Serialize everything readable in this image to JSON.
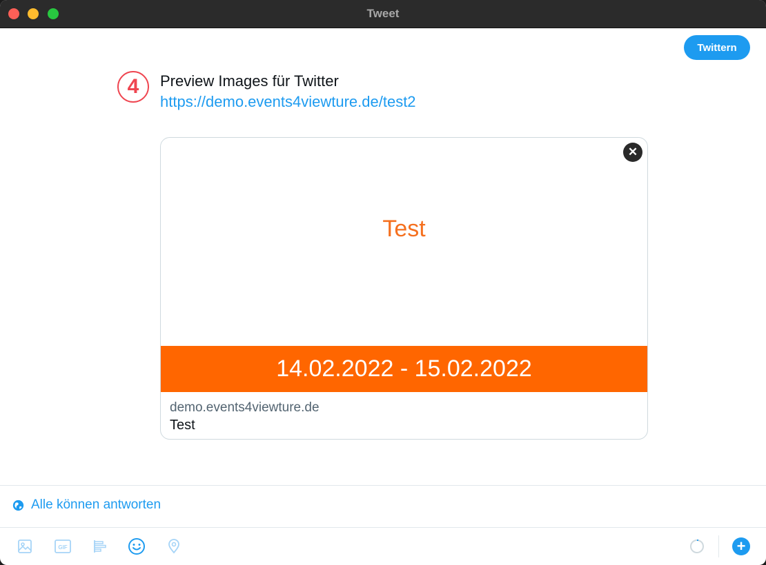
{
  "window": {
    "title": "Tweet"
  },
  "compose": {
    "tweet_button": "Twittern",
    "step_badge": "4",
    "text": "Preview Images für Twitter",
    "link": "https://demo.events4viewture.de/test2"
  },
  "card": {
    "image_title": "Test",
    "image_date_band": "14.02.2022 - 15.02.2022",
    "domain": "demo.events4viewture.de",
    "description": "Test",
    "close_icon": "close-icon"
  },
  "reply_setting": {
    "label": "Alle können antworten",
    "icon": "globe-icon"
  },
  "toolbar": {
    "icons": [
      "image-icon",
      "gif-icon",
      "poll-icon",
      "emoji-icon",
      "location-icon"
    ],
    "gif_label": "GIF",
    "add_label": "+"
  },
  "colors": {
    "accent": "#1d9bf0",
    "orange": "#ff6600",
    "step_badge": "#ef4550"
  }
}
